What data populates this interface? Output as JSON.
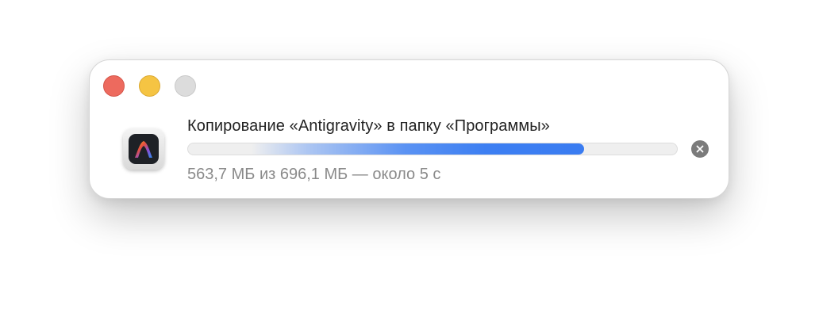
{
  "window": {
    "title_text": "Копирование «Antigravity» в папку «Программы»",
    "status_text": "563,7 МБ из 696,1 МБ — около 5 с",
    "progress_fraction": 0.8098,
    "copied": "563,7 МБ",
    "total": "696,1 МБ",
    "remaining": "около 5 с"
  },
  "icons": {
    "app": "antigravity-app-icon",
    "cancel": "cancel-x-icon"
  },
  "colors": {
    "traffic_close": "#ed6a5e",
    "traffic_minimize": "#f5c443",
    "traffic_zoom": "#dcdcdc",
    "progress_accent": "#3a7cf1",
    "status_text": "#8a8a8a"
  }
}
